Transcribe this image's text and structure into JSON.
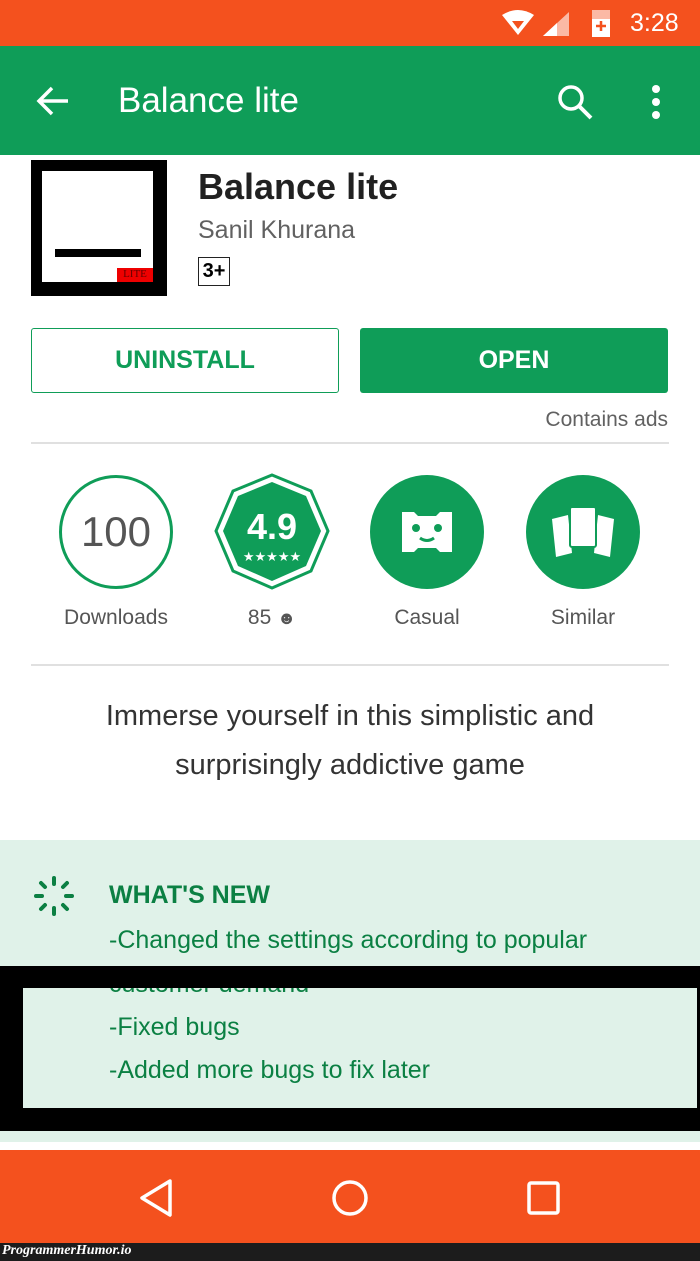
{
  "status_bar": {
    "time": "3:28",
    "color": "#F4511E"
  },
  "app_bar": {
    "title": "Balance lite",
    "color": "#0F9D58"
  },
  "app": {
    "name": "Balance lite",
    "developer": "Sanil Khurana",
    "content_rating": "3+",
    "icon_badge": "LITE"
  },
  "actions": {
    "uninstall": "UNINSTALL",
    "open": "OPEN",
    "contains_ads": "Contains ads"
  },
  "stats": {
    "downloads_value": "100",
    "downloads_label": "Downloads",
    "rating_value": "4.9",
    "rating_stars": 4.5,
    "rating_count": "85",
    "category": "Casual",
    "similar": "Similar"
  },
  "description": {
    "line1": "Immerse yourself in this simplistic and",
    "line2": "surprisingly addictive game"
  },
  "whats_new": {
    "title": "WHAT'S NEW",
    "lines": [
      "-Changed the settings according to popular",
      "customer demand",
      "-Fixed bugs",
      "-Added more bugs to fix later"
    ]
  },
  "watermark": "ProgrammerHumor.io"
}
